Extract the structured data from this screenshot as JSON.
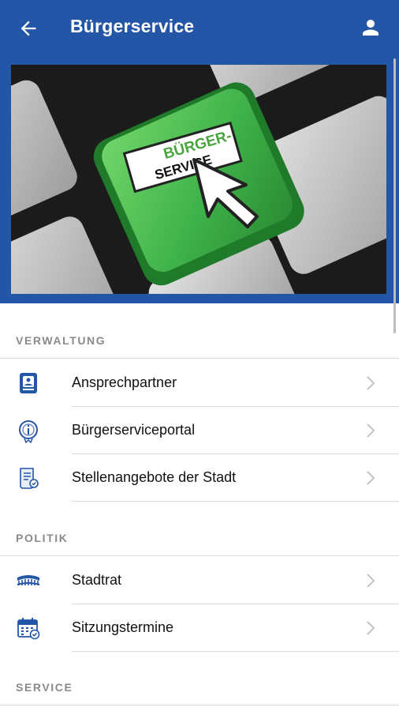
{
  "appbar": {
    "title": "Bürgerservice",
    "back_icon": "arrow-left-icon",
    "profile_icon": "person-icon",
    "color": "#2456a7"
  },
  "hero": {
    "key_text_line1": "BÜRGER-",
    "key_text_line2": "SERVICE",
    "key_color": "#3fb34a"
  },
  "sections": [
    {
      "header": "VERWALTUNG",
      "items": [
        {
          "label": "Ansprechpartner",
          "icon": "contact-book-icon"
        },
        {
          "label": "Bürgerserviceportal",
          "icon": "info-seal-icon"
        },
        {
          "label": "Stellenangebote der Stadt",
          "icon": "document-scroll-icon"
        }
      ]
    },
    {
      "header": "POLITIK",
      "items": [
        {
          "label": "Stadtrat",
          "icon": "council-bench-icon"
        },
        {
          "label": "Sitzungstermine",
          "icon": "calendar-check-icon"
        }
      ]
    },
    {
      "header": "SERVICE",
      "items": []
    }
  ]
}
